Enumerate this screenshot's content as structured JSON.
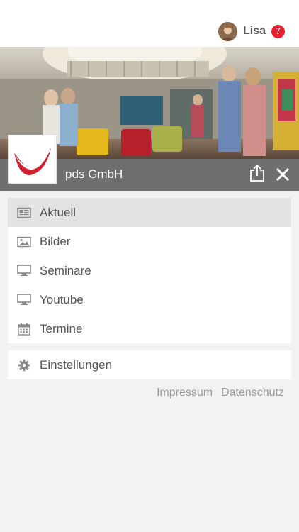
{
  "header": {
    "user_name": "Lisa",
    "notification_count": "7"
  },
  "brand": {
    "name": "pds GmbH"
  },
  "menu": {
    "items": [
      {
        "label": "Aktuell",
        "icon": "newspaper-icon",
        "active": true
      },
      {
        "label": "Bilder",
        "icon": "image-icon",
        "active": false
      },
      {
        "label": "Seminare",
        "icon": "monitor-icon",
        "active": false
      },
      {
        "label": "Youtube",
        "icon": "monitor-icon",
        "active": false
      },
      {
        "label": "Termine",
        "icon": "calendar-icon",
        "active": false
      }
    ],
    "settings_label": "Einstellungen"
  },
  "footer": {
    "impressum": "Impressum",
    "datenschutz": "Datenschutz"
  },
  "colors": {
    "accent_red": "#e4202e",
    "brand_bar": "#6f6f6f",
    "active_item": "#e2e2e2"
  }
}
